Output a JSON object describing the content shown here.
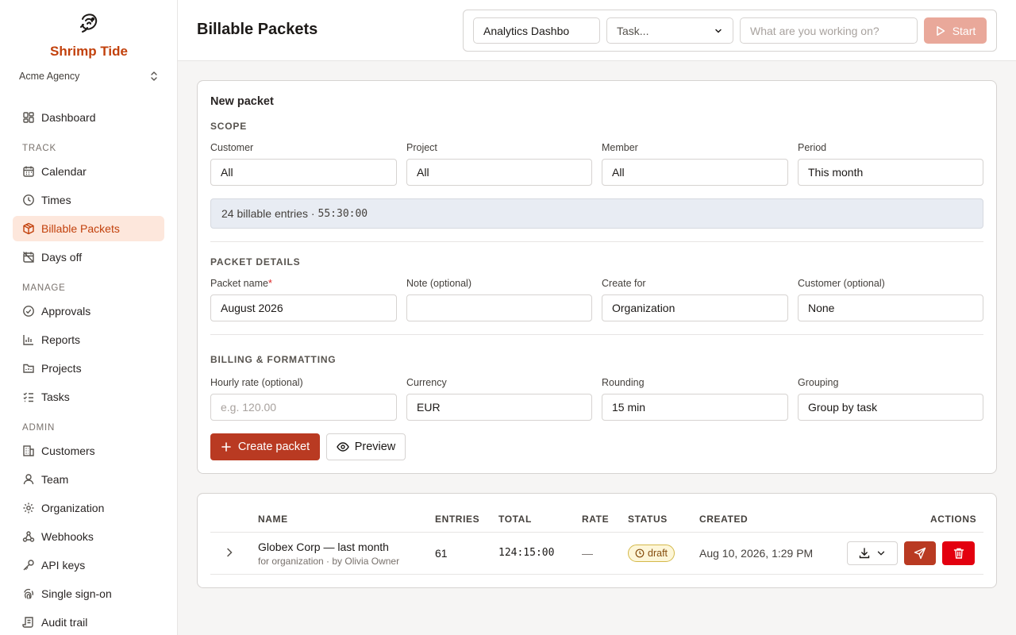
{
  "sidebar": {
    "brand": "Shrimp Tide",
    "org": "Acme Agency",
    "dashboard": "Dashboard",
    "sections": {
      "track": "TRACK",
      "manage": "MANAGE",
      "admin": "ADMIN"
    },
    "items": {
      "calendar": "Calendar",
      "times": "Times",
      "billable_packets": "Billable Packets",
      "days_off": "Days off",
      "approvals": "Approvals",
      "reports": "Reports",
      "projects": "Projects",
      "tasks": "Tasks",
      "customers": "Customers",
      "team": "Team",
      "organization": "Organization",
      "webhooks": "Webhooks",
      "api_keys": "API keys",
      "sso": "Single sign-on",
      "audit": "Audit trail"
    },
    "active": "billable_packets"
  },
  "header": {
    "title": "Billable Packets",
    "timer": {
      "project_value": "Analytics Dashbo",
      "task_label": "Task...",
      "description_placeholder": "What are you working on?",
      "start_label": "Start"
    }
  },
  "new_packet": {
    "title": "New packet",
    "scope": {
      "heading": "SCOPE",
      "customer_label": "Customer",
      "customer_value": "All",
      "project_label": "Project",
      "project_value": "All",
      "member_label": "Member",
      "member_value": "All",
      "period_label": "Period",
      "period_value": "This month",
      "summary_text": "24 billable entries ·",
      "summary_time": "55:30:00"
    },
    "details": {
      "heading": "PACKET DETAILS",
      "name_label": "Packet name",
      "name_required": "*",
      "name_value": "August 2026",
      "note_label": "Note (optional)",
      "note_value": "",
      "create_for_label": "Create for",
      "create_for_value": "Organization",
      "customer_label": "Customer (optional)",
      "customer_value": "None"
    },
    "billing": {
      "heading": "BILLING & FORMATTING",
      "rate_label": "Hourly rate (optional)",
      "rate_placeholder": "e.g. 120.00",
      "currency_label": "Currency",
      "currency_value": "EUR",
      "rounding_label": "Rounding",
      "rounding_value": "15 min",
      "grouping_label": "Grouping",
      "grouping_value": "Group by task"
    },
    "create_button": "Create packet",
    "preview_button": "Preview"
  },
  "packets_table": {
    "columns": {
      "name": "NAME",
      "entries": "ENTRIES",
      "total": "TOTAL",
      "rate": "RATE",
      "status": "STATUS",
      "created": "CREATED",
      "actions": "ACTIONS"
    },
    "rows": [
      {
        "name": "Globex Corp — last month",
        "sub": "for organization · by Olivia Owner",
        "entries": "61",
        "total": "124:15:00",
        "rate": "—",
        "status": "draft",
        "created": "Aug 10, 2026, 1:29 PM"
      }
    ]
  },
  "colors": {
    "accent": "#b93a22",
    "brand": "#c2410c",
    "active_nav_bg": "#fde7dc",
    "danger": "#e3000f",
    "draft_badge_bg": "#fdf6d8"
  }
}
